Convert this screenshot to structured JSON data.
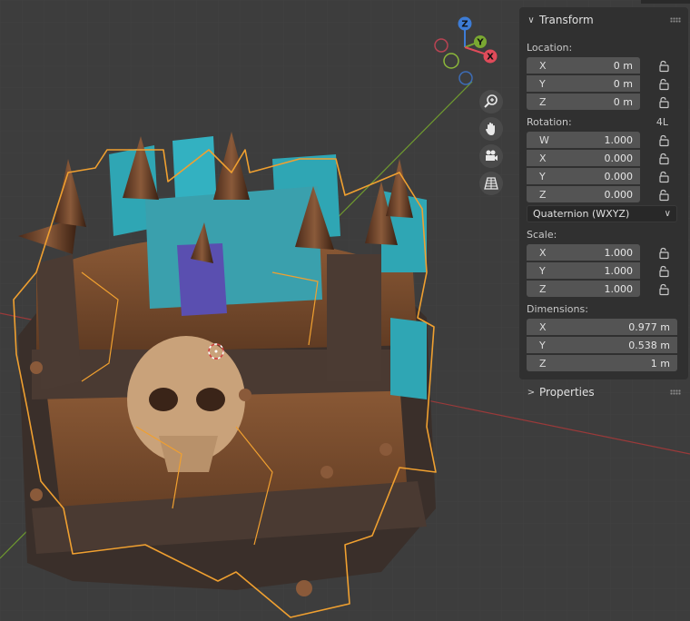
{
  "viewport": {
    "navigation": [
      "zoom-icon",
      "pan-icon",
      "camera-icon",
      "grid-icon"
    ],
    "gizmo": {
      "z": "Z",
      "y": "Y",
      "x": "X"
    },
    "colors": {
      "background": "#3d3d3d",
      "selection_outline": "#f0a030",
      "x_axis": "#b03a3a",
      "y_axis": "#6f9a2f"
    }
  },
  "panel": {
    "transform_header": "Transform",
    "location_label": "Location:",
    "location": [
      {
        "axis": "X",
        "value": "0 m"
      },
      {
        "axis": "Y",
        "value": "0 m"
      },
      {
        "axis": "Z",
        "value": "0 m"
      }
    ],
    "rotation_label": "Rotation:",
    "rotation_mode_short": "4L",
    "rotation": [
      {
        "axis": "W",
        "value": "1.000"
      },
      {
        "axis": "X",
        "value": "0.000"
      },
      {
        "axis": "Y",
        "value": "0.000"
      },
      {
        "axis": "Z",
        "value": "0.000"
      }
    ],
    "rotation_mode": "Quaternion (WXYZ)",
    "scale_label": "Scale:",
    "scale": [
      {
        "axis": "X",
        "value": "1.000"
      },
      {
        "axis": "Y",
        "value": "1.000"
      },
      {
        "axis": "Z",
        "value": "1.000"
      }
    ],
    "dimensions_label": "Dimensions:",
    "dimensions": [
      {
        "axis": "X",
        "value": "0.977 m"
      },
      {
        "axis": "Y",
        "value": "0.538 m"
      },
      {
        "axis": "Z",
        "value": "1 m"
      }
    ],
    "properties_header": "Properties"
  }
}
